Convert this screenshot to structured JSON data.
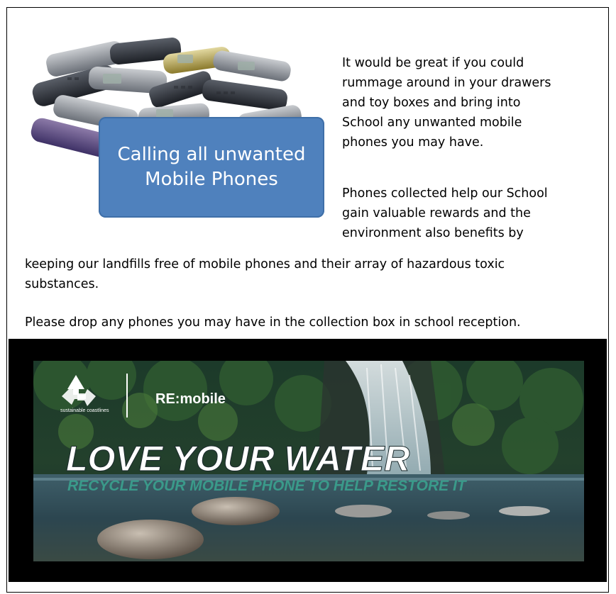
{
  "callout": {
    "line1": "Calling all unwanted",
    "line2": "Mobile Phones"
  },
  "intro": {
    "lines": [
      "It would be great if you could",
      "rummage around in your drawers",
      "and toy boxes and bring into",
      "School any unwanted mobile",
      "phones you may have."
    ]
  },
  "benefits": {
    "lines": [
      "Phones collected help our School",
      "gain valuable rewards and the",
      "environment also benefits by"
    ],
    "continuation": [
      "keeping our landfills free of mobile phones and their array of hazardous toxic",
      "substances."
    ]
  },
  "dropoff": "Please drop any phones you may have in the collection box in school reception.",
  "banner": {
    "brand": "RE:mobile",
    "sub_brand": "sustainable coastlines",
    "headline": "LOVE YOUR WATER",
    "tagline": "RECYCLE YOUR MOBILE PHONE TO HELP RESTORE IT"
  },
  "colors": {
    "callout": "#4f81bd",
    "tagline": "#3a9a8a",
    "frame": "#000000"
  }
}
